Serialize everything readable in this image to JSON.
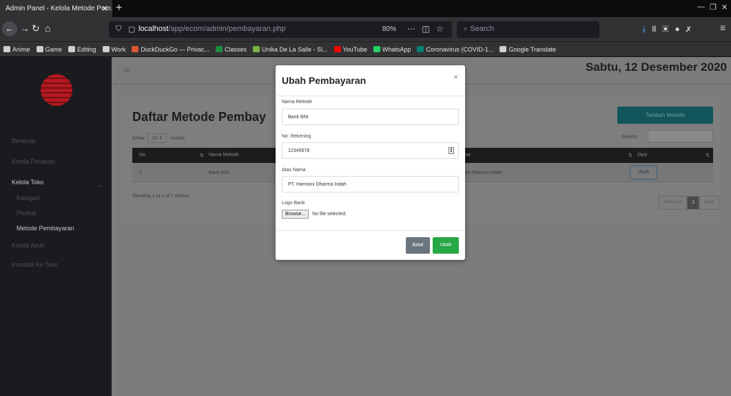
{
  "browser": {
    "tab_title": "Admin Panel - Kelola Metode Pem…",
    "url_host": "localhost",
    "url_path": "/app/ecom/admin/pembayaran.php",
    "zoom": "80%",
    "search_placeholder": "Search",
    "bookmarks": [
      {
        "label": "Anime",
        "icon": "folder-icon",
        "color": "#cfcfcf"
      },
      {
        "label": "Game",
        "icon": "folder-icon",
        "color": "#cfcfcf"
      },
      {
        "label": "Editing",
        "icon": "folder-icon",
        "color": "#cfcfcf"
      },
      {
        "label": "Work",
        "icon": "folder-icon",
        "color": "#cfcfcf"
      },
      {
        "label": "DuckDuckGo — Privac...",
        "icon": "duckduckgo-icon",
        "color": "#de5833"
      },
      {
        "label": "Classes",
        "icon": "classroom-icon",
        "color": "#1e8e3e"
      },
      {
        "label": "Unika De La Salle - Sl...",
        "icon": "unika-icon",
        "color": "#7cb342"
      },
      {
        "label": "YouTube",
        "icon": "youtube-icon",
        "color": "#ff0000"
      },
      {
        "label": "WhatsApp",
        "icon": "whatsapp-icon",
        "color": "#25d366"
      },
      {
        "label": "Coronavirus (COVID-1...",
        "icon": "bing-icon",
        "color": "#008373"
      },
      {
        "label": "Google Translate",
        "icon": "globe-icon",
        "color": "#cfcfcf"
      }
    ]
  },
  "sidebar": {
    "items": [
      {
        "label": "Beranda"
      },
      {
        "label": "Kelola Pesanan"
      },
      {
        "label": "Kelola Toko"
      },
      {
        "label": "Kategori"
      },
      {
        "label": "Produk"
      },
      {
        "label": "Metode Pembayaran"
      },
      {
        "label": "Kelola Akun"
      },
      {
        "label": "Kembali Ke Toko"
      }
    ]
  },
  "header": {
    "date": "Sabtu, 12 Desember 2020"
  },
  "card": {
    "title": "Daftar Metode Pembay",
    "add_button": "Tambah Metode",
    "show_label": "Show",
    "show_value": "10",
    "entries_label": "entries",
    "search_label": "Search:",
    "columns": [
      "No.",
      "Nama Metode",
      "ma",
      "Opsi"
    ],
    "rows": [
      {
        "no": "1",
        "nama": "Bank BNI",
        "atas_nama": "oni Dharma Indah",
        "action": "Ubah"
      }
    ],
    "info": "Showing 1 to 1 of 1 entries",
    "pager": {
      "previous": "Previous",
      "current": "1",
      "next": "Next"
    }
  },
  "modal": {
    "title": "Ubah Pembayaran",
    "close": "×",
    "nama_label": "Nama Metode",
    "nama_value": "Bank BNI",
    "rek_label": "No. Rekening",
    "rek_value": "12345678",
    "atas_label": "Atas Nama",
    "atas_value": "PT. Harmoni Dharma Indah",
    "logo_label": "Logo Bank",
    "browse_label": "Browse...",
    "file_status": "No file selected.",
    "cancel_label": "Batal",
    "submit_label": "Ubah"
  }
}
